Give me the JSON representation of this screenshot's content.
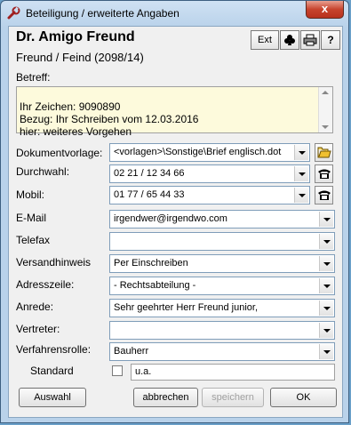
{
  "window": {
    "title": "Beteiligung / erweiterte Angaben",
    "close_label": "x"
  },
  "header": {
    "name": "Dr. Amigo Freund",
    "role": "Freund / Feind (2098/14)",
    "ext_label": "Ext"
  },
  "betreff": {
    "label": "Betreff:",
    "text": "Ihr Zeichen: 9090890\nBezug: Ihr Schreiben vom 12.03.2016\nhier: weiteres Vorgehen"
  },
  "fields": {
    "dokumentvorlage": {
      "label": "Dokumentvorlage:",
      "value": "<vorlagen>\\Sonstige\\Brief englisch.dot"
    },
    "durchwahl": {
      "label": "Durchwahl:",
      "value": "02 21 / 12 34 66"
    },
    "mobil": {
      "label": "Mobil:",
      "value": "01 77 / 65 44 33"
    },
    "email": {
      "label": "E-Mail",
      "value": "irgendwer@irgendwo.com"
    },
    "telefax": {
      "label": "Telefax",
      "value": ""
    },
    "versandhinweis": {
      "label": "Versandhinweis",
      "value": "Per Einschreiben"
    },
    "adresszeile": {
      "label": "Adresszeile:",
      "value": "- Rechtsabteilung -"
    },
    "anrede": {
      "label": "Anrede:",
      "value": "Sehr geehrter Herr Freund junior,"
    },
    "vertreter": {
      "label": "Vertreter:",
      "value": ""
    },
    "verfahrensrolle": {
      "label": "Verfahrensrolle:",
      "value": "Bauherr"
    },
    "standard": {
      "label": "Standard",
      "text": "u.a."
    }
  },
  "buttons": {
    "auswahl": "Auswahl",
    "abbrechen": "abbrechen",
    "speichern": "speichern",
    "ok": "OK"
  }
}
